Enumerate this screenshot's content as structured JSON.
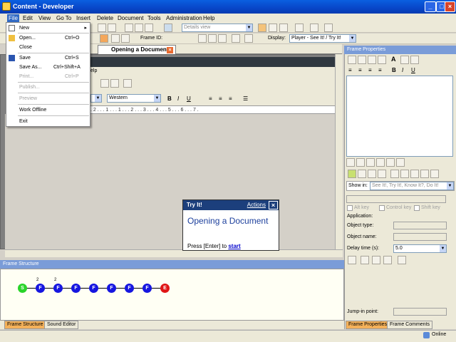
{
  "window": {
    "title": "Content - Developer"
  },
  "menubar": [
    "File",
    "Edit",
    "View",
    "Go To",
    "Insert",
    "Delete",
    "Document",
    "Tools",
    "Administration",
    "Help"
  ],
  "file_menu": [
    {
      "label": "New",
      "shortcut": "",
      "submenu": true,
      "disabled": false
    },
    {
      "label": "Open...",
      "shortcut": "Ctrl+O",
      "disabled": false
    },
    {
      "label": "Close",
      "shortcut": "",
      "disabled": false
    },
    {
      "label": "Save",
      "shortcut": "Ctrl+S",
      "disabled": false
    },
    {
      "label": "Save As...",
      "shortcut": "Ctrl+Shift+A",
      "disabled": false
    },
    {
      "label": "Print...",
      "shortcut": "Ctrl+P",
      "disabled": true
    },
    {
      "label": "Publish...",
      "shortcut": "",
      "disabled": true
    },
    {
      "label": "Preview",
      "shortcut": "",
      "disabled": true
    },
    {
      "label": "Work Offline",
      "shortcut": "",
      "disabled": false
    },
    {
      "label": "Exit",
      "shortcut": "",
      "disabled": false
    }
  ],
  "toolbar": {
    "frame_id_label": "Frame ID:",
    "view_combo": "Details view",
    "display_label": "Display:",
    "display_value": "Player - See It! / Try It!"
  },
  "doc_tab": {
    "title": "Opening a Document"
  },
  "editor": {
    "menu_fragment": "elp",
    "font": "Western",
    "ruler": ". 2 . . . 1 . . . 1 . . . 2 . . . 3 . . . 4 . . . 5 . . . 6 . . . 7 ."
  },
  "tryit": {
    "head": "Try It!",
    "actions": "Actions",
    "title": "Opening a Document",
    "text": "Press [Enter] to ",
    "link": "start"
  },
  "frame_structure": {
    "title": "Frame Structure",
    "nodes": [
      "S",
      "F",
      "F",
      "F",
      "F",
      "F",
      "F",
      "F",
      "E"
    ],
    "superscripts": [
      "2",
      "2"
    ]
  },
  "bottom_tabs": [
    "Frame Structure",
    "Sound Editor"
  ],
  "frame_properties": {
    "title": "Frame Properties",
    "show_in_label": "Show in:",
    "show_in_value": "See It!, Try It!, Know It?, Do It!",
    "alt_key": "Alt key",
    "control_key": "Control key",
    "shift_key": "Shift key",
    "application": "Application:",
    "object_type": "Object type:",
    "object_name": "Object name:",
    "delay_label": "Delay time (s):",
    "delay_value": "5.0",
    "jump_in": "Jump-in point:",
    "tabs": [
      "Frame Properties",
      "Frame Comments"
    ]
  },
  "status": {
    "online": "Online"
  }
}
